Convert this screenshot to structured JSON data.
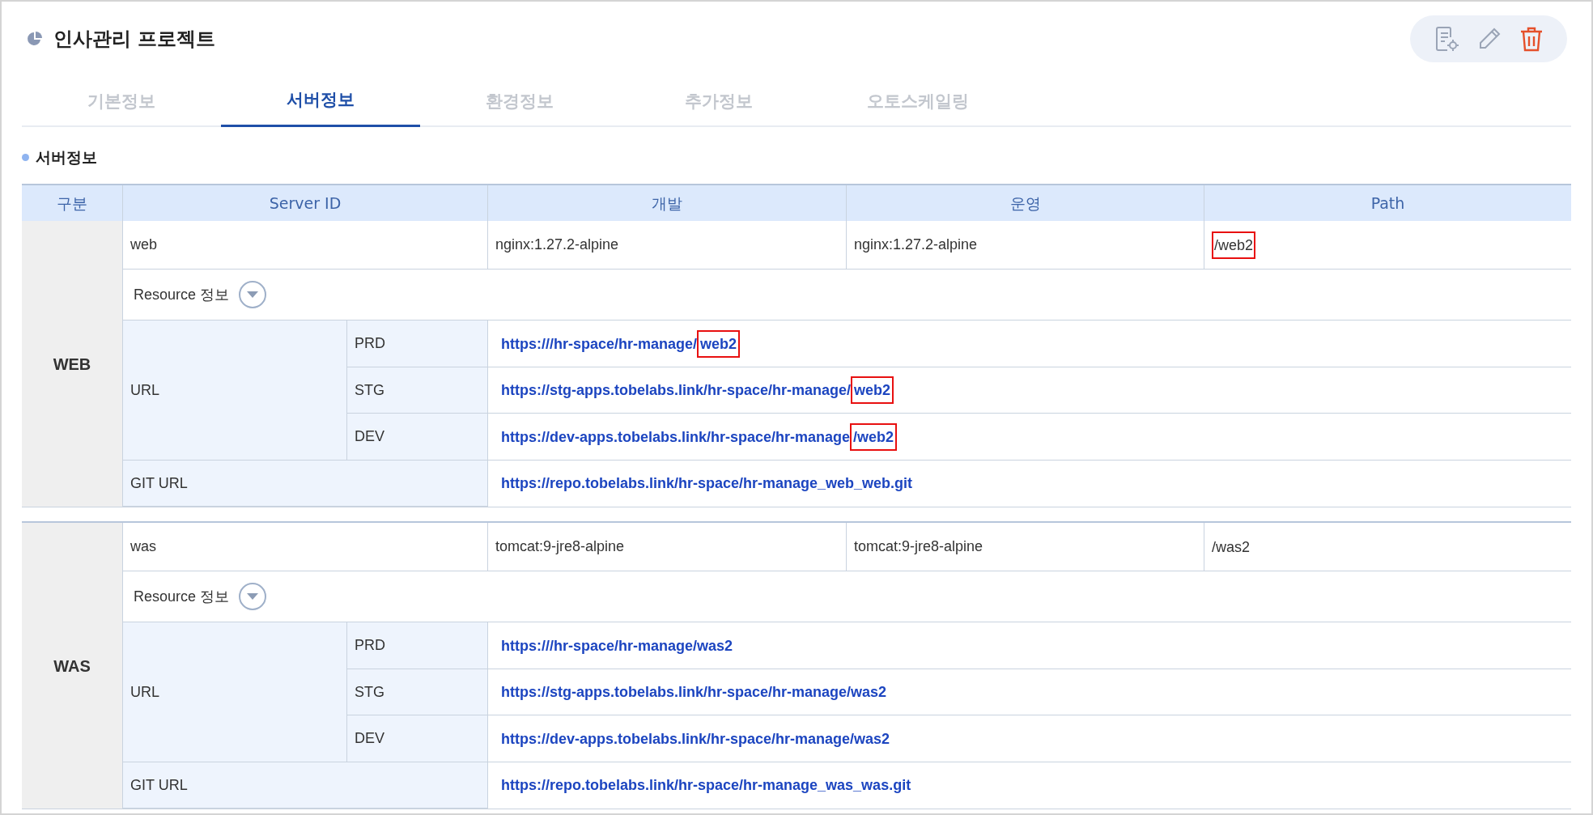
{
  "title": "인사관리 프로젝트",
  "tabs": [
    {
      "label": "기본정보",
      "selected": false
    },
    {
      "label": "서버정보",
      "selected": true
    },
    {
      "label": "환경정보",
      "selected": false
    },
    {
      "label": "추가정보",
      "selected": false
    },
    {
      "label": "오토스케일링",
      "selected": false
    }
  ],
  "section_title": "서버정보",
  "table": {
    "columns": [
      "구분",
      "Server ID",
      "개발",
      "운영",
      "Path"
    ],
    "groups": [
      {
        "label": "WEB",
        "server_id": "web",
        "dev": "nginx:1.27.2-alpine",
        "prod": "nginx:1.27.2-alpine",
        "path": {
          "text": "/web2",
          "highlighted": true
        },
        "resource_label": "Resource 정보",
        "url_label": "URL",
        "urls": [
          {
            "env": "PRD",
            "parts": [
              {
                "text": "https:///hr-space/hr-manage/",
                "highlighted": false
              },
              {
                "text": "web2",
                "highlighted": true
              }
            ]
          },
          {
            "env": "STG",
            "parts": [
              {
                "text": "https://stg-apps.tobelabs.link/hr-space/hr-manage/",
                "highlighted": false
              },
              {
                "text": "web2",
                "highlighted": true
              }
            ]
          },
          {
            "env": "DEV",
            "parts": [
              {
                "text": "https://dev-apps.tobelabs.link/hr-space/hr-manage",
                "highlighted": false
              },
              {
                "text": "/web2",
                "highlighted": true
              }
            ]
          }
        ],
        "git_label": "GIT URL",
        "git_url": "https://repo.tobelabs.link/hr-space/hr-manage_web_web.git"
      },
      {
        "label": "WAS",
        "server_id": "was",
        "dev": "tomcat:9-jre8-alpine",
        "prod": "tomcat:9-jre8-alpine",
        "path": {
          "text": "/was2",
          "highlighted": false
        },
        "resource_label": "Resource 정보",
        "url_label": "URL",
        "urls": [
          {
            "env": "PRD",
            "parts": [
              {
                "text": "https:///hr-space/hr-manage/was2",
                "highlighted": false
              }
            ]
          },
          {
            "env": "STG",
            "parts": [
              {
                "text": "https://stg-apps.tobelabs.link/hr-space/hr-manage/was2",
                "highlighted": false
              }
            ]
          },
          {
            "env": "DEV",
            "parts": [
              {
                "text": "https://dev-apps.tobelabs.link/hr-space/hr-manage/was2",
                "highlighted": false
              }
            ]
          }
        ],
        "git_label": "GIT URL",
        "git_url": "https://repo.tobelabs.link/hr-space/hr-manage_was_was.git"
      }
    ]
  }
}
